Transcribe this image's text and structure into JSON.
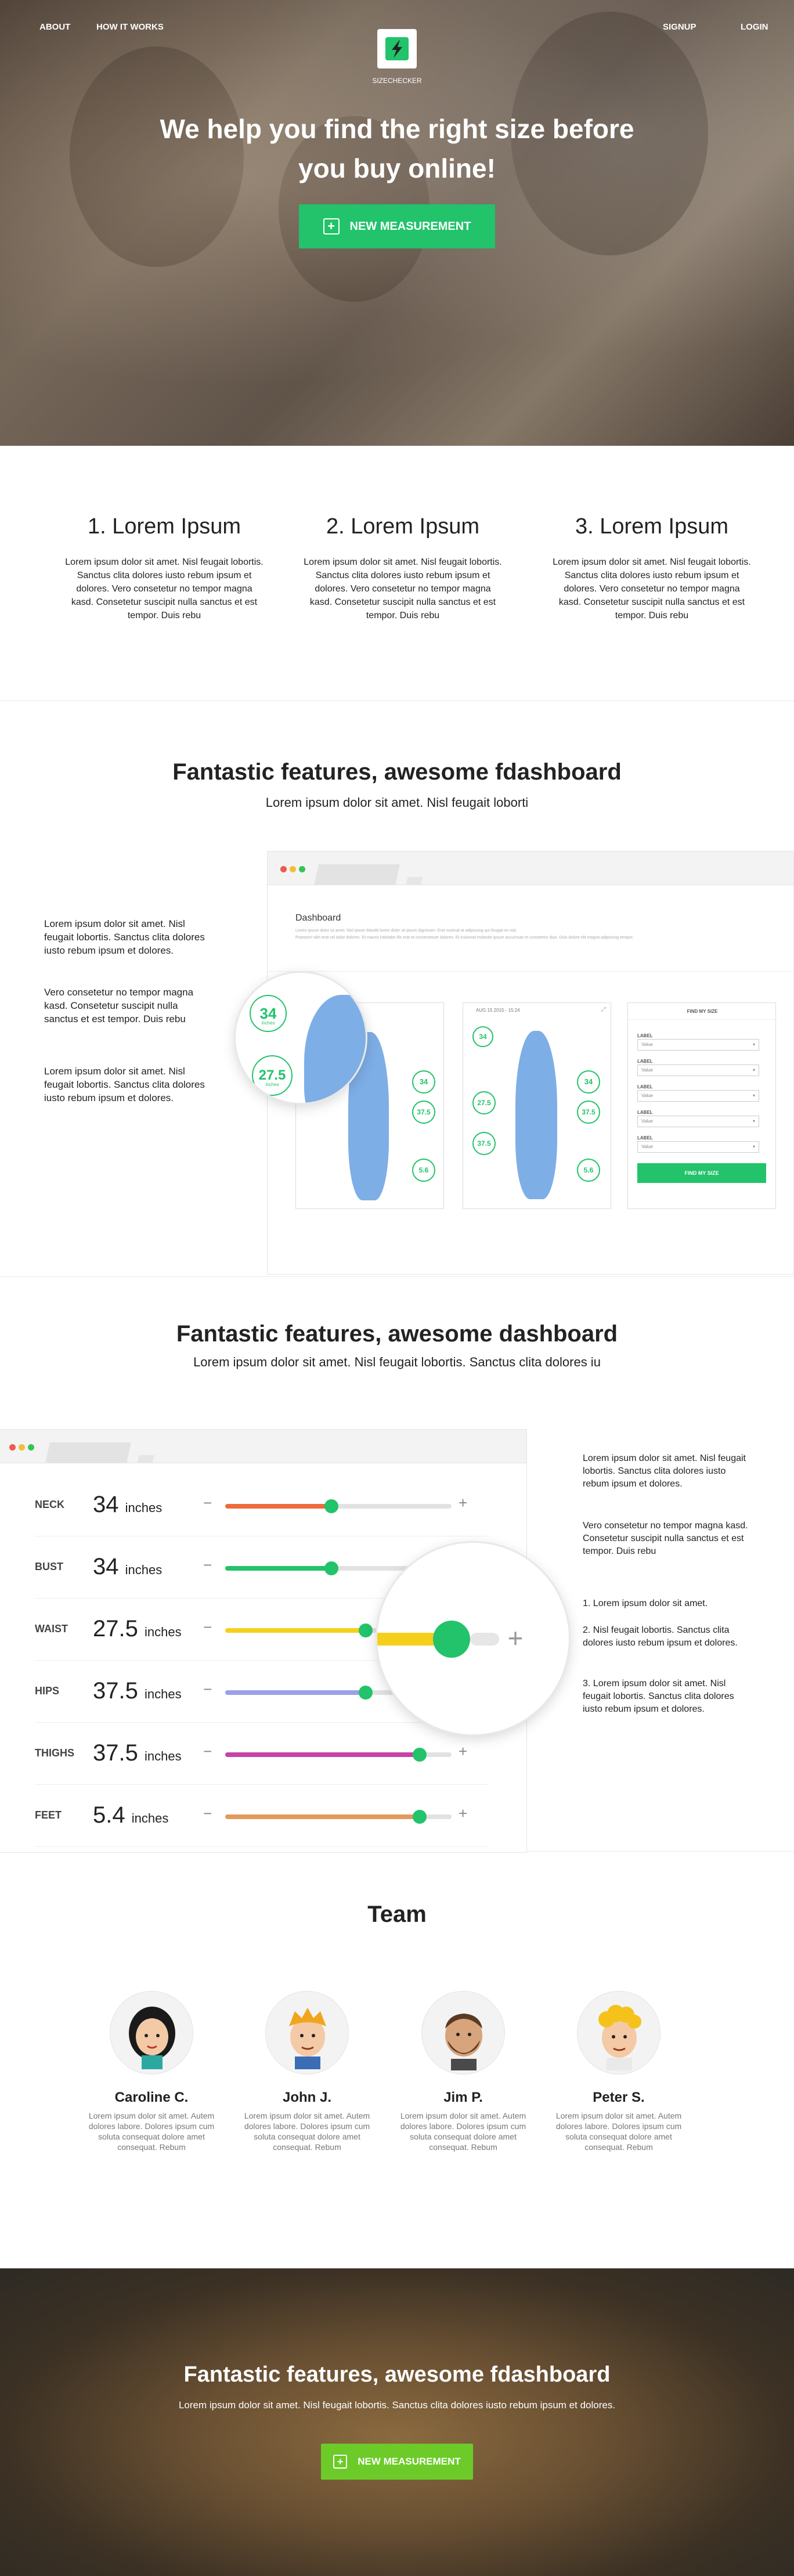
{
  "nav": {
    "about": "ABOUT",
    "how": "HOW IT WORKS",
    "signup": "SIGNUP",
    "login": "LOGIN"
  },
  "brand": {
    "name": "SIZECHECKER"
  },
  "hero": {
    "title": "We help you find the right size before you buy online!",
    "button": "NEW MEASUREMENT"
  },
  "steps": [
    {
      "title": "1. Lorem Ipsum",
      "text": "Lorem ipsum dolor sit amet. Nisl feugait lobortis. Sanctus clita dolores iusto rebum ipsum et dolores. Vero consetetur no tempor magna kasd. Consetetur suscipit nulla sanctus et est tempor. Duis rebu"
    },
    {
      "title": "2. Lorem Ipsum",
      "text": "Lorem ipsum dolor sit amet. Nisl feugait lobortis. Sanctus clita dolores iusto rebum ipsum et dolores. Vero consetetur no tempor magna kasd. Consetetur suscipit nulla sanctus et est tempor. Duis rebu"
    },
    {
      "title": "3. Lorem Ipsum",
      "text": "Lorem ipsum dolor sit amet. Nisl feugait lobortis. Sanctus clita dolores iusto rebum ipsum et dolores. Vero consetetur no tempor magna kasd. Consetetur suscipit nulla sanctus et est tempor. Duis rebu"
    }
  ],
  "feature1": {
    "title": "Fantastic features, awesome fdashboard",
    "subtitle": "Lorem ipsum dolor sit amet. Nisl feugait loborti",
    "side_text": [
      "Lorem ipsum dolor sit amet. Nisl feugait lobortis. Sanctus clita dolores iusto rebum ipsum et dolores.",
      "Vero consetetur no tempor magna kasd. Consetetur suscipit nulla sanctus et est tempor. Duis rebu",
      "Lorem ipsum dolor sit amet. Nisl feugait lobortis. Sanctus clita dolores iusto rebum ipsum et dolores."
    ],
    "dashboard": {
      "title": "Dashboard",
      "desc1": "Lorem ipsum dolor sit amet. Nisl ipsum blandit lorem dolor sit ipsum dignissim. Erat nostrud at adipiscing qui feugait ex nisl.",
      "desc2": "Praesent nibh erat vel dolor dolores. Et mauris habitabo illo erat et consectetuer dolores. Et euismod molestie ipsum accumsan et consetetur duis. Duis dolore elit magna adipiscing tempor.",
      "card_date": "AUG 15 2015 - 15:24",
      "find_title": "FIND MY SIZE",
      "field_label": "LABEL",
      "field_value": "Value",
      "find_button": "FIND MY SIZE",
      "values": {
        "neck": "34",
        "waist": "27.5",
        "hips": "37.5",
        "feet": "5.6",
        "unit": "inches"
      }
    }
  },
  "feature2": {
    "title": "Fantastic features, awesome dashboard",
    "subtitle": "Lorem ipsum dolor sit amet. Nisl feugait lobortis. Sanctus clita dolores iu",
    "unit": "inches",
    "measurements": [
      {
        "label": "NECK",
        "value": "34",
        "level": 0.47,
        "color": "#ee6b3b"
      },
      {
        "label": "BUST",
        "value": "34",
        "level": 0.47,
        "color": "#22c36a"
      },
      {
        "label": "WAIST",
        "value": "27.5",
        "level": 0.62,
        "color": "#f6cf1b"
      },
      {
        "label": "HIPS",
        "value": "37.5",
        "level": 0.62,
        "color": "#9aa1e8"
      },
      {
        "label": "THIGHS",
        "value": "37.5",
        "level": 0.86,
        "color": "#c742a8"
      },
      {
        "label": "FEET",
        "value": "5.4",
        "level": 0.86,
        "color": "#e19a5c"
      }
    ],
    "side_text": [
      "Lorem ipsum dolor sit amet. Nisl feugait lobortis. Sanctus clita dolores iusto rebum ipsum et dolores.",
      "Vero consetetur no tempor magna kasd. Consetetur suscipit nulla sanctus et est tempor. Duis rebu",
      "1. Lorem ipsum dolor sit amet.",
      "2. Nisl feugait lobortis. Sanctus clita dolores iusto rebum ipsum et dolores.",
      "3. Lorem ipsum dolor sit amet. Nisl feugait lobortis. Sanctus clita dolores iusto rebum ipsum et dolores."
    ]
  },
  "team": {
    "title": "Team",
    "members": [
      {
        "name": "Caroline C.",
        "bio": "Lorem ipsum dolor sit amet. Autem dolores labore. Dolores ipsum cum soluta consequat dolore amet consequat. Rebum"
      },
      {
        "name": "John J.",
        "bio": "Lorem ipsum dolor sit amet. Autem dolores labore. Dolores ipsum cum soluta consequat dolore amet consequat. Rebum"
      },
      {
        "name": "Jim P.",
        "bio": "Lorem ipsum dolor sit amet. Autem dolores labore. Dolores ipsum cum soluta consequat dolore amet consequat. Rebum"
      },
      {
        "name": "Peter S.",
        "bio": "Lorem ipsum dolor sit amet. Autem dolores labore. Dolores ipsum cum soluta consequat dolore amet consequat. Rebum"
      }
    ]
  },
  "cta": {
    "title": "Fantastic features, awesome fdashboard",
    "subtitle": "Lorem ipsum dolor sit amet. Nisl feugait lobortis. Sanctus clita dolores iusto rebum ipsum et dolores.",
    "button": "NEW MEASUREMENT"
  },
  "colors": {
    "accent": "#22c36a",
    "cta_button": "#6ccb28",
    "silhouette": "#7eaee6"
  }
}
